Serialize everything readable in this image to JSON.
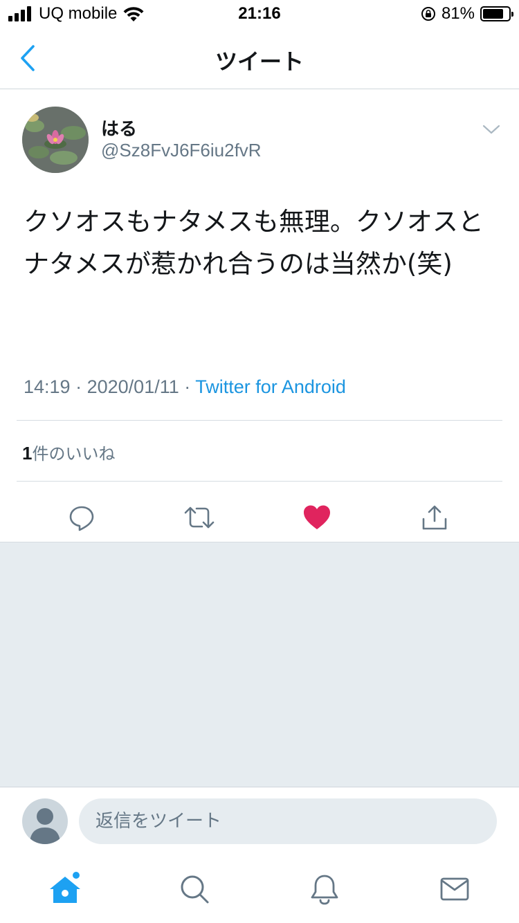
{
  "status_bar": {
    "carrier": "UQ mobile",
    "time": "21:16",
    "battery_percent": "81%",
    "battery_level": 0.81
  },
  "nav": {
    "title": "ツイート",
    "accent_color": "#1da1f2"
  },
  "tweet": {
    "display_name": "はる",
    "handle": "@Sz8FvJ6F6iu2fvR",
    "text": "クソオスもナタメスも無理。クソオスとナタメスが惹かれ合うのは当然か(笑)",
    "time": "14:19",
    "date": "2020/01/11",
    "separator": "·",
    "source": "Twitter for Android",
    "likes_count": "1",
    "likes_label": "件のいいね",
    "liked": true,
    "like_color": "#e0245e"
  },
  "reply": {
    "placeholder": "返信をツイート"
  },
  "icons": {
    "back": "chevron-left-icon",
    "caret": "chevron-down-icon",
    "reply": "comment-icon",
    "retweet": "retweet-icon",
    "like": "heart-icon",
    "share": "share-icon",
    "home": "home-icon",
    "search": "search-icon",
    "notifications": "bell-icon",
    "messages": "envelope-icon"
  }
}
